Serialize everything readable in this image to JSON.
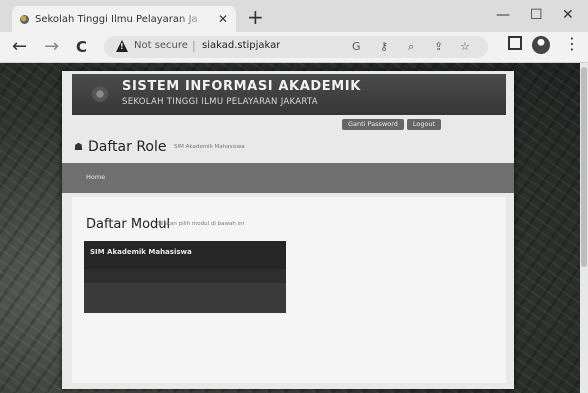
{
  "browser": {
    "tab_title": "Sekolah Tinggi Ilmu Pelayaran Ja",
    "tab_close": "✕",
    "new_tab": "+",
    "window_controls": {
      "minimize": "—",
      "maximize": "☐",
      "close": "✕"
    },
    "nav": {
      "back": "←",
      "forward": "→",
      "reload": "C"
    },
    "security_label": "Not secure",
    "separator": "|",
    "url": "siakad.stipjakarta.ac.i",
    "toolbar_icons": [
      "translate-icon",
      "key-icon",
      "zoom-icon",
      "share-icon",
      "star-icon",
      "extensions-icon",
      "profile-icon",
      "menu-icon"
    ]
  },
  "header": {
    "title": "SISTEM INFORMASI AKADEMIK",
    "subtitle": "SEKOLAH TINGGI ILMU PELAYARAN JAKARTA"
  },
  "top_buttons": {
    "password": "Ganti Password",
    "logout": "Logout"
  },
  "role_section": {
    "title": "Daftar Role",
    "subtitle": "SIM Akademik Mahasiswa"
  },
  "nav": {
    "home": "Home"
  },
  "modul_section": {
    "title": "Daftar Modul",
    "subtitle": "Silakan pilih modul di bawah ini",
    "cards": [
      {
        "label": "SIM Akademik Mahasiswa"
      }
    ]
  },
  "colors": {
    "header_bg": "#3f3f3f",
    "navbar_bg": "#6f6f6f",
    "card_bg": "#3a3a3a"
  }
}
